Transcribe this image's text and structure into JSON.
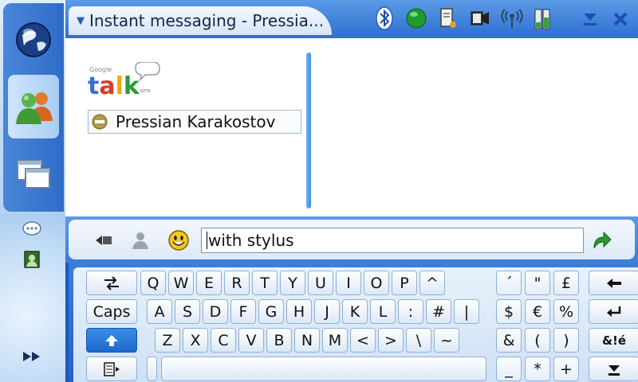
{
  "window": {
    "title": "Instant messaging - Pressia..."
  },
  "contact": {
    "name": "Pressian Karakostov",
    "status": "busy"
  },
  "logo": {
    "brand": "Google",
    "word": "talk",
    "tag": "BETA"
  },
  "message": {
    "value": "with stylus"
  },
  "icons": {
    "sidebar": [
      "globe-icon",
      "contacts-icon",
      "windows-icon",
      "chat-bubble-icon",
      "contact-card-icon",
      "fast-forward-icon"
    ],
    "status": [
      "bluetooth-icon",
      "online-presence-icon",
      "document-icon",
      "battery-icon",
      "signal-icon",
      "battery-level-icon"
    ],
    "input": [
      "back-icon",
      "contact-icon",
      "smiley-icon",
      "send-icon"
    ]
  },
  "keyboard": {
    "rows": [
      [
        "Q",
        "W",
        "E",
        "R",
        "T",
        "Y",
        "U",
        "I",
        "O",
        "P",
        "^"
      ],
      [
        "A",
        "S",
        "D",
        "F",
        "G",
        "H",
        "J",
        "K",
        "L",
        ":",
        "#",
        "|"
      ],
      [
        "Z",
        "X",
        "C",
        "V",
        "B",
        "N",
        "M",
        "<",
        ">",
        "\\",
        "~"
      ]
    ],
    "symbols": [
      [
        "´",
        "\"",
        "£"
      ],
      [
        "$",
        "€",
        "%"
      ],
      [
        "&",
        "(",
        ")"
      ],
      [
        "_",
        "*",
        "+"
      ]
    ],
    "caps_label": "Caps",
    "special_label": "&!é"
  },
  "colors": {
    "accent": "#2d6fd0",
    "panel": "#e8f1fb",
    "shift_active": "#1e68cc"
  }
}
